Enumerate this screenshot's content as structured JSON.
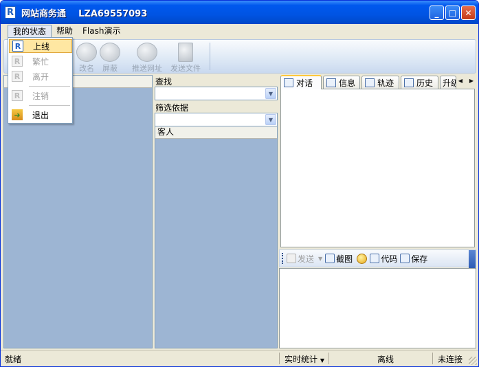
{
  "window": {
    "app_name": "网站商务通",
    "account_id": "LZA69557093",
    "icon_glyph": "R",
    "buttons": {
      "minimize": "_",
      "maximize": "□",
      "close": "✕"
    }
  },
  "menubar": {
    "items": [
      {
        "label": "我的状态"
      },
      {
        "label": "帮助"
      },
      {
        "label": "Flash演示"
      }
    ]
  },
  "status_menu": {
    "items": [
      {
        "label": "上线",
        "icon": "R",
        "state": "highlighted"
      },
      {
        "label": "繁忙",
        "icon": "R",
        "state": "disabled"
      },
      {
        "label": "离开",
        "icon": "R",
        "state": "disabled"
      },
      {
        "label": "注销",
        "icon": "R",
        "state": "disabled"
      },
      {
        "label": "退出",
        "icon": "exit-icon",
        "state": "enabled"
      }
    ]
  },
  "toolbar": {
    "buttons": [
      {
        "label": "改名",
        "icon": "rename-icon"
      },
      {
        "label": "屏蔽",
        "icon": "block-icon"
      },
      {
        "label": "推送网址",
        "icon": "push-url-icon"
      },
      {
        "label": "发送文件",
        "icon": "send-file-icon"
      }
    ]
  },
  "search": {
    "label": "查找",
    "filter_label": "筛选依据",
    "search_value": "",
    "filter_value": ""
  },
  "guest_list": {
    "header": "客人"
  },
  "tabs": [
    {
      "label": "对话",
      "active": true
    },
    {
      "label": "信息"
    },
    {
      "label": "轨迹"
    },
    {
      "label": "历史"
    },
    {
      "label": "升级"
    }
  ],
  "input_toolbar": {
    "send": "发送",
    "screenshot": "截图",
    "code": "代码",
    "save": "保存"
  },
  "statusbar": {
    "ready": "就绪",
    "realtime": "实时统计",
    "online_status": "离线",
    "connection": "未连接"
  },
  "colors": {
    "titlebar": "#0054e3",
    "pane_bg": "#9db5d3",
    "highlight": "#ffe7a2"
  }
}
